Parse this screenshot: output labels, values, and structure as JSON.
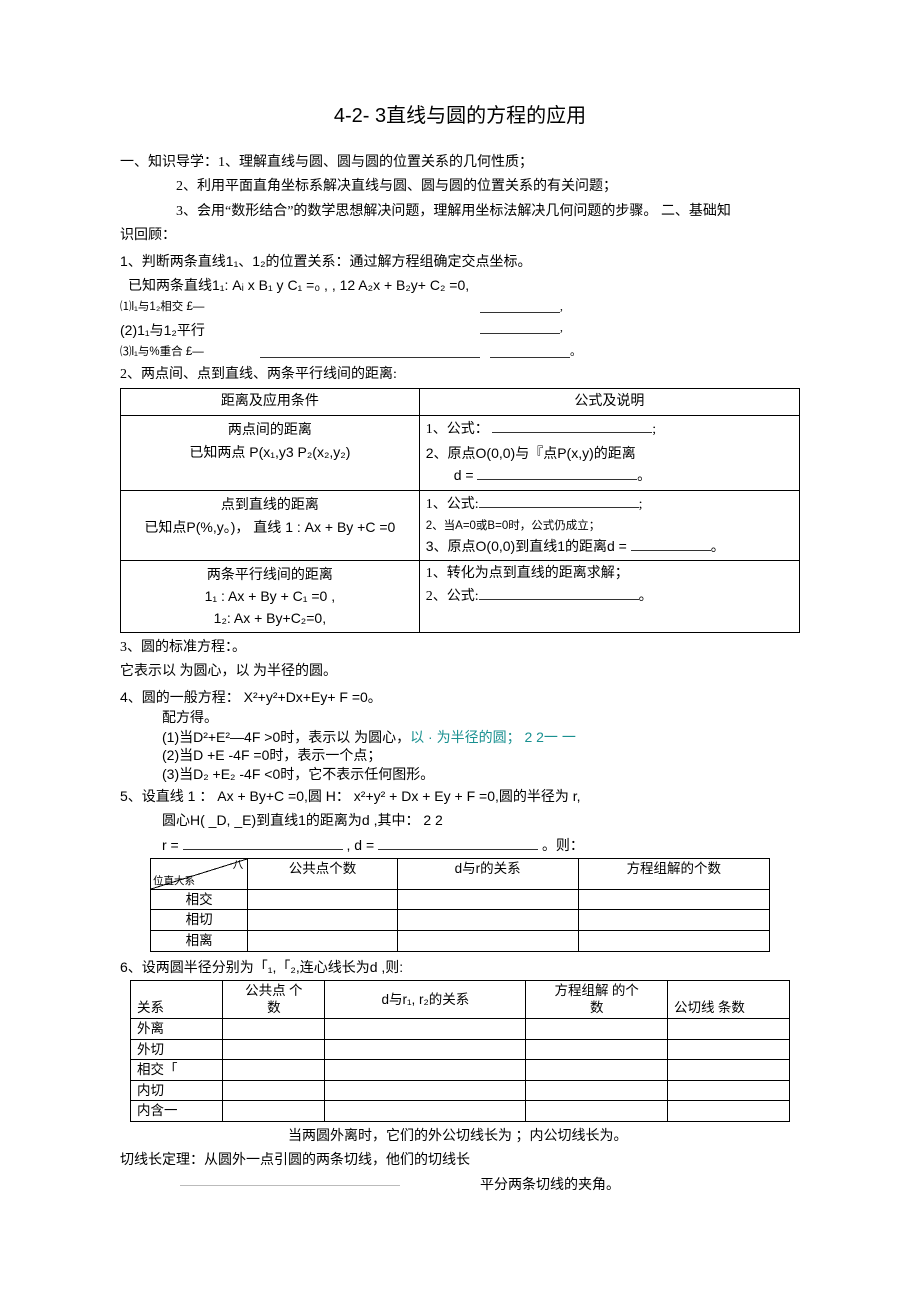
{
  "title": "4-2- 3直线与圆的方程的应用",
  "guide": {
    "head": "一、知识导学：",
    "g1": "1、理解直线与圆、圆与圆的位置关系的几何性质；",
    "g2": "2、利用平面直角坐标系解决直线与圆、圆与圆的位置关系的有关问题；",
    "g3_a": "3、会用“数形结合”的数学思想解决问题，理解用坐标法解决几何问题的步骤。",
    "g3_b": "  二、基础知",
    "g3_c": "识回顾："
  },
  "q1": {
    "head": "1、判断两条直线1₁、1₂的位置关系：通过解方程组确定交点坐标。",
    "given": "已知两条直线1₁:   Aᵢ x B₁ y C₁    =₀ , ,  12   A₂x + B₂y+ C₂ =0,",
    "c1_l": "⑴l₁与1₂相交     £—",
    "c1_r": ",",
    "c2_l": "(2)1₁与1₂平行",
    "c2_r": ",",
    "c3_l": "⑶l₁与%重合     £—",
    "c3_r": "。"
  },
  "q2_head": "2、两点间、点到直线、两条平行线间的距离:",
  "table1": {
    "h1": "距离及应用条件",
    "h2": "公式及说明",
    "r1c1a": "两点间的距离",
    "r1c1b": "已知两点 P(x₁,y3 P₂(x₂,y₂)",
    "r1c2_l1": "1、公式：",
    "r1c2_l1_b": ";",
    "r1c2_l2": "2、原点O(0,0)与『点P(x,y)的距离",
    "r1c2_l3": "d =",
    "r1c2_l3_b": "。",
    "r2c1a": "点到直线的距离",
    "r2c1b": "已知点P(%,y。)，  直线 1 : Ax + By +C =0",
    "r2c2_l1": "1、公式:",
    "r2c2_l1_b": ";",
    "r2c2_l2": "2、当A=0或B=0时，公式仍成立；",
    "r2c2_l3": "3、原点O(0,0)到直线1的距离d =",
    "r2c2_l3_b": "。",
    "r3c1a": "两条平行线间的距离",
    "r3c1b": "1₁ : Ax + By + C₁ =0 ,",
    "r3c1c": "1₂:  Ax + By+C₂=0,",
    "r3c2_l1": "1、转化为点到直线的距离求解；",
    "r3c2_l2": "2、公式:",
    "r3c2_l2_b": "。"
  },
  "q3": {
    "a": "3、圆的标准方程：。",
    "b": "它表示以 为圆心，以 为半径的圆。"
  },
  "q4": {
    "a": "4、圆的一般方程： X²+y²+Dx+Ey+ F =0。",
    "b": "配方得。",
    "c1": "(1)当D²+E²—4F >0时，表示以 为圆心，",
    "c1t": "以 · 为半径的圆；   2       2一  一",
    "c2": "(2)当D +E -4F =0时，表示一个点；",
    "c3": "(3)当D₂ +E₂ -4F <0时，它不表示任何图形。"
  },
  "q5": {
    "a": "5、设直线 1 ： Ax + By+C =0,圆 H：  x²+y² + Dx + Ey + F =0,圆的半径为 r,",
    "b": "圆心H( _D,  _E)到直线1的距离为d ,其中：  2  2",
    "c_l": "r =",
    "c_m": ", d =",
    "c_r": "。则："
  },
  "table2": {
    "h1a": "八",
    "h1b": "位直大系",
    "h2": "公共点个数",
    "h3": "d与r的关系",
    "h4": "方程组解的个数",
    "r1": "相交",
    "r2": "相切",
    "r3": "相离"
  },
  "q6_head": "6、设两圆半径分别为「₁,「₂,连心线长为d ,则:",
  "table3": {
    "h1": "关系",
    "h2a": "公共点  个",
    "h2b": "数",
    "h3": "d与r₁, r₂的关系",
    "h4a": "方程组解   的个",
    "h4b": "数",
    "h5": "公切线  条数",
    "r1": "外离",
    "r2": "外切",
    "r3": "相交「",
    "r4": "内切",
    "r5": "内含一"
  },
  "tail": {
    "a": "当两圆外离时，它们的外公切线长为 ；内公切线长为。",
    "b": "切线长定理：从圆外一点引圆的两条切线，他们的切线长",
    "c": "平分两条切线的夹角。"
  }
}
